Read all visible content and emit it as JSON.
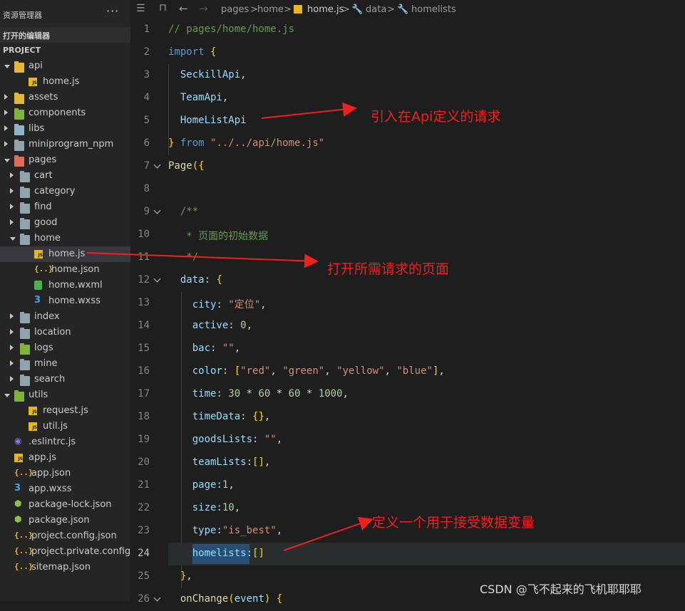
{
  "sidebar": {
    "title": "资源管理器",
    "more": "···",
    "open_editors": "打开的编辑器",
    "project": "PROJECT",
    "tree": [
      {
        "label": "api",
        "kind": "folder",
        "color": "#e2b93d",
        "depth": 0,
        "open": true
      },
      {
        "label": "home.js",
        "kind": "js",
        "depth": 1
      },
      {
        "label": "assets",
        "kind": "folder",
        "color": "#e2b93d",
        "depth": 0,
        "open": false
      },
      {
        "label": "components",
        "kind": "folder",
        "color": "#7fb33a",
        "depth": 0,
        "open": false
      },
      {
        "label": "libs",
        "kind": "folder",
        "color": "#8fb3c8",
        "depth": 0,
        "open": false
      },
      {
        "label": "miniprogram_npm",
        "kind": "folder",
        "color": "#90a4ae",
        "depth": 0,
        "open": false
      },
      {
        "label": "pages",
        "kind": "folder",
        "color": "#e06c5a",
        "depth": 0,
        "open": true
      },
      {
        "label": "cart",
        "kind": "folder",
        "color": "#90a4ae",
        "depth": 1,
        "open": false
      },
      {
        "label": "category",
        "kind": "folder",
        "color": "#90a4ae",
        "depth": 1,
        "open": false
      },
      {
        "label": "find",
        "kind": "folder",
        "color": "#90a4ae",
        "depth": 1,
        "open": false
      },
      {
        "label": "good",
        "kind": "folder",
        "color": "#90a4ae",
        "depth": 1,
        "open": false
      },
      {
        "label": "home",
        "kind": "folder",
        "color": "#90a4ae",
        "depth": 1,
        "open": true
      },
      {
        "label": "home.js",
        "kind": "js",
        "depth": 2,
        "selected": true
      },
      {
        "label": "home.json",
        "kind": "json",
        "depth": 2
      },
      {
        "label": "home.wxml",
        "kind": "wxml",
        "depth": 2
      },
      {
        "label": "home.wxss",
        "kind": "css",
        "depth": 2
      },
      {
        "label": "index",
        "kind": "folder",
        "color": "#90a4ae",
        "depth": 1,
        "open": false
      },
      {
        "label": "location",
        "kind": "folder",
        "color": "#90a4ae",
        "depth": 1,
        "open": false
      },
      {
        "label": "logs",
        "kind": "folder",
        "color": "#7fb33a",
        "depth": 1,
        "open": false
      },
      {
        "label": "mine",
        "kind": "folder",
        "color": "#90a4ae",
        "depth": 1,
        "open": false
      },
      {
        "label": "search",
        "kind": "folder",
        "color": "#90a4ae",
        "depth": 1,
        "open": false
      },
      {
        "label": "utils",
        "kind": "folder",
        "color": "#7fb33a",
        "depth": 0,
        "open": true
      },
      {
        "label": "request.js",
        "kind": "js",
        "depth": 1
      },
      {
        "label": "util.js",
        "kind": "js",
        "depth": 1
      },
      {
        "label": ".eslintrc.js",
        "kind": "eslint",
        "depth": 0
      },
      {
        "label": "app.js",
        "kind": "js",
        "depth": 0
      },
      {
        "label": "app.json",
        "kind": "json",
        "depth": 0
      },
      {
        "label": "app.wxss",
        "kind": "css",
        "depth": 0
      },
      {
        "label": "package-lock.json",
        "kind": "node",
        "depth": 0
      },
      {
        "label": "package.json",
        "kind": "node",
        "depth": 0
      },
      {
        "label": "project.config.json",
        "kind": "json",
        "depth": 0
      },
      {
        "label": "project.private.config.js...",
        "kind": "json",
        "depth": 0
      },
      {
        "label": "sitemap.json",
        "kind": "json",
        "depth": 0
      }
    ]
  },
  "breadcrumb": {
    "parts": [
      "pages",
      "home",
      "home.js",
      "data",
      "homelists"
    ],
    "sep": ">"
  },
  "code": [
    {
      "n": "1",
      "t": [
        [
          "cm",
          "// pages/home/home.js"
        ]
      ]
    },
    {
      "n": "2",
      "t": [
        [
          "kw",
          "import"
        ],
        [
          "pl",
          " "
        ],
        [
          "pu",
          "{"
        ]
      ]
    },
    {
      "n": "3",
      "t": [
        [
          "pl",
          "  "
        ],
        [
          "id",
          "SeckillApi"
        ],
        [
          "pl",
          ","
        ]
      ]
    },
    {
      "n": "4",
      "t": [
        [
          "pl",
          "  "
        ],
        [
          "id",
          "TeamApi"
        ],
        [
          "pl",
          ","
        ]
      ]
    },
    {
      "n": "5",
      "t": [
        [
          "pl",
          "  "
        ],
        [
          "id",
          "HomeListApi"
        ]
      ]
    },
    {
      "n": "6",
      "t": [
        [
          "pu",
          "}"
        ],
        [
          "pl",
          " "
        ],
        [
          "kw",
          "from"
        ],
        [
          "pl",
          " "
        ],
        [
          "st",
          "\"../../api/home.js\""
        ]
      ]
    },
    {
      "n": "7",
      "t": [
        [
          "fn",
          "Page"
        ],
        [
          "pu",
          "({"
        ]
      ],
      "fold": true
    },
    {
      "n": "8",
      "t": []
    },
    {
      "n": "9",
      "t": [
        [
          "pl",
          "  "
        ],
        [
          "cm",
          "/**"
        ]
      ],
      "fold": true
    },
    {
      "n": "10",
      "t": [
        [
          "pl",
          "   "
        ],
        [
          "cm",
          "* 页面的初始数据"
        ]
      ]
    },
    {
      "n": "11",
      "t": [
        [
          "pl",
          "   "
        ],
        [
          "cm",
          "*/"
        ]
      ]
    },
    {
      "n": "12",
      "t": [
        [
          "pl",
          "  "
        ],
        [
          "id",
          "data"
        ],
        [
          "pl",
          ": "
        ],
        [
          "pu",
          "{"
        ]
      ],
      "fold": true
    },
    {
      "n": "13",
      "t": [
        [
          "pl",
          "    "
        ],
        [
          "id",
          "city"
        ],
        [
          "pl",
          ": "
        ],
        [
          "st",
          "\"定位\""
        ],
        [
          "pl",
          ","
        ]
      ]
    },
    {
      "n": "14",
      "t": [
        [
          "pl",
          "    "
        ],
        [
          "id",
          "active"
        ],
        [
          "pl",
          ": "
        ],
        [
          "nu",
          "0"
        ],
        [
          "pl",
          ","
        ]
      ]
    },
    {
      "n": "15",
      "t": [
        [
          "pl",
          "    "
        ],
        [
          "id",
          "bac"
        ],
        [
          "pl",
          ": "
        ],
        [
          "st",
          "\"\""
        ],
        [
          "pl",
          ","
        ]
      ]
    },
    {
      "n": "16",
      "t": [
        [
          "pl",
          "    "
        ],
        [
          "id",
          "color"
        ],
        [
          "pl",
          ": "
        ],
        [
          "pu",
          "["
        ],
        [
          "st",
          "\"red\""
        ],
        [
          "pl",
          ", "
        ],
        [
          "st",
          "\"green\""
        ],
        [
          "pl",
          ", "
        ],
        [
          "st",
          "\"yellow\""
        ],
        [
          "pl",
          ", "
        ],
        [
          "st",
          "\"blue\""
        ],
        [
          "pu",
          "]"
        ],
        [
          "pl",
          ","
        ]
      ]
    },
    {
      "n": "17",
      "t": [
        [
          "pl",
          "    "
        ],
        [
          "id",
          "time"
        ],
        [
          "pl",
          ": "
        ],
        [
          "nu",
          "30"
        ],
        [
          "pl",
          " * "
        ],
        [
          "nu",
          "60"
        ],
        [
          "pl",
          " * "
        ],
        [
          "nu",
          "60"
        ],
        [
          "pl",
          " * "
        ],
        [
          "nu",
          "1000"
        ],
        [
          "pl",
          ","
        ]
      ]
    },
    {
      "n": "18",
      "t": [
        [
          "pl",
          "    "
        ],
        [
          "id",
          "timeData"
        ],
        [
          "pl",
          ": "
        ],
        [
          "pu",
          "{}"
        ],
        [
          "pl",
          ","
        ]
      ]
    },
    {
      "n": "19",
      "t": [
        [
          "pl",
          "    "
        ],
        [
          "id",
          "goodsLists"
        ],
        [
          "pl",
          ": "
        ],
        [
          "st",
          "\"\""
        ],
        [
          "pl",
          ","
        ]
      ]
    },
    {
      "n": "20",
      "t": [
        [
          "pl",
          "    "
        ],
        [
          "id",
          "teamLists"
        ],
        [
          "pl",
          ":"
        ],
        [
          "pu",
          "[]"
        ],
        [
          "pl",
          ","
        ]
      ]
    },
    {
      "n": "21",
      "t": [
        [
          "pl",
          "    "
        ],
        [
          "id",
          "page"
        ],
        [
          "pl",
          ":"
        ],
        [
          "nu",
          "1"
        ],
        [
          "pl",
          ","
        ]
      ]
    },
    {
      "n": "22",
      "t": [
        [
          "pl",
          "    "
        ],
        [
          "id",
          "size"
        ],
        [
          "pl",
          ":"
        ],
        [
          "nu",
          "10"
        ],
        [
          "pl",
          ","
        ]
      ]
    },
    {
      "n": "23",
      "t": [
        [
          "pl",
          "    "
        ],
        [
          "id",
          "type"
        ],
        [
          "pl",
          ":"
        ],
        [
          "st",
          "\"is_best\""
        ],
        [
          "pl",
          ","
        ]
      ]
    },
    {
      "n": "24",
      "t": [
        [
          "pl",
          "    "
        ],
        [
          "id",
          "homelists"
        ],
        [
          "pl",
          ":"
        ],
        [
          "pu",
          "[]"
        ]
      ],
      "current": true
    },
    {
      "n": "25",
      "t": [
        [
          "pl",
          "  "
        ],
        [
          "pu",
          "}"
        ],
        [
          "pl",
          ","
        ]
      ]
    },
    {
      "n": "26",
      "t": [
        [
          "pl",
          "  "
        ],
        [
          "fn",
          "onChange"
        ],
        [
          "pu",
          "("
        ],
        [
          "id",
          "event"
        ],
        [
          "pu",
          ")"
        ],
        [
          "pl",
          " "
        ],
        [
          "pu",
          "{"
        ]
      ],
      "fold": true
    }
  ],
  "annotations": {
    "a1": "引入在Api定义的请求",
    "a2": "打开所需请求的页面",
    "a3": "定义一个用于接受数据变量"
  },
  "colors": {
    "annotation": "#f02020",
    "background": "#1e1e1e",
    "sidebar": "#252526"
  },
  "watermark": "CSDN @飞不起来的飞机耶耶耶"
}
